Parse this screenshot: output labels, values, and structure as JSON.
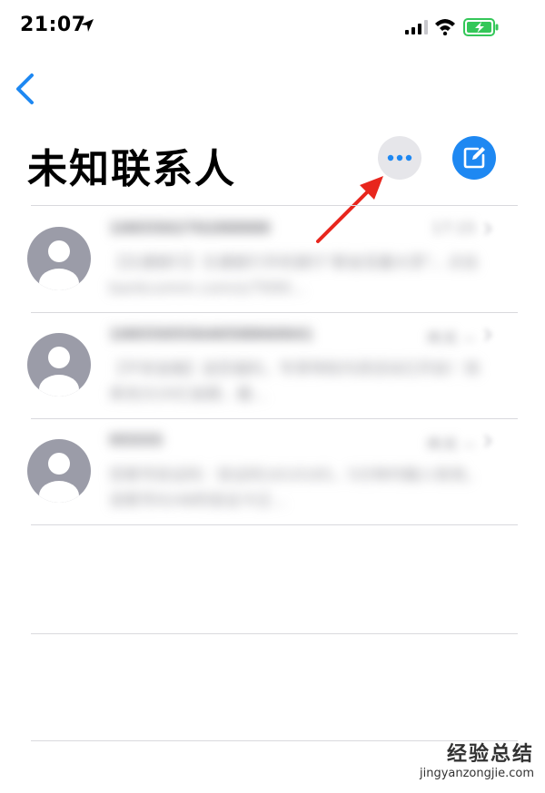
{
  "status_bar": {
    "time": "21:07",
    "icons": [
      "location-arrow-icon",
      "cellular-signal-icon",
      "wifi-icon",
      "battery-charging-icon"
    ]
  },
  "nav": {
    "back_icon": "chevron-left-icon"
  },
  "header": {
    "title": "未知联系人",
    "more_icon": "ellipsis-icon",
    "compose_icon": "compose-icon"
  },
  "colors": {
    "accent": "#1e88f2",
    "more_button_bg": "#e6e6ea",
    "battery_green": "#34c759",
    "annotation_arrow": "#e8261d"
  },
  "messages": [
    {
      "sender": "106550270288888",
      "time": "17:15",
      "preview": "【交通银行】交通银行手机银行\"薪金至赢大赏\"，点击 bankcomm.com/s/7000..."
    },
    {
      "sender": "1065505564058866841",
      "time": "昨天 ~",
      "preview": "【平安金融】送您福利，专享特权内测活动已开启！快来充分20亿金额，最..."
    },
    {
      "sender": "95555",
      "time": "昨天 ~",
      "preview": "您尾号验证码：验证码1610165，5分钟内输入有效，该尾号9248的验证卡正..."
    }
  ],
  "watermark": {
    "chinese": "经验总结",
    "url": "jingyanzongjie.com"
  }
}
